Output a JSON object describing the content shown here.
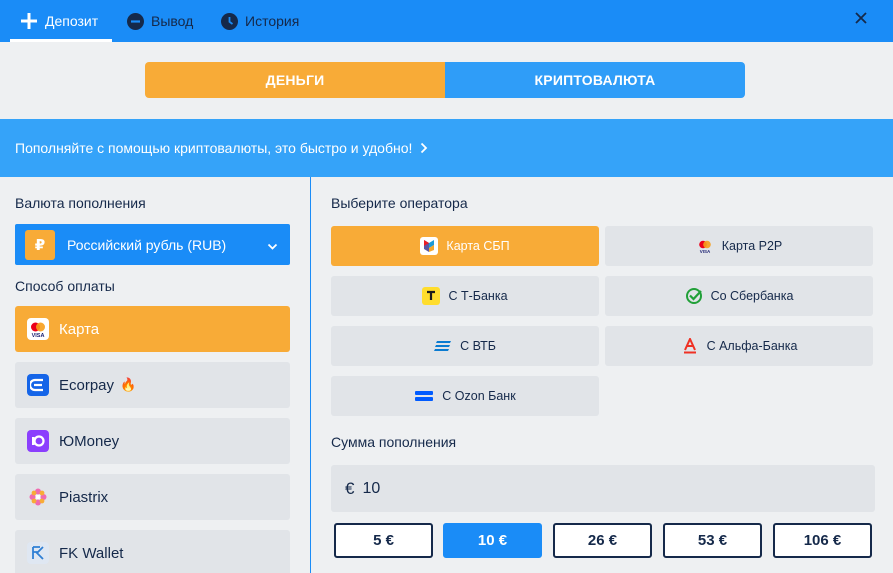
{
  "tabs": [
    {
      "label": "Депозит",
      "icon": "plus-icon",
      "active": true
    },
    {
      "label": "Вывод",
      "icon": "minus-circle-icon"
    },
    {
      "label": "История",
      "icon": "clock-icon"
    }
  ],
  "mode_switch": {
    "money": "ДЕНЬГИ",
    "crypto": "КРИПТОВАЛЮТА",
    "active": "money"
  },
  "banner": {
    "text": "Пополняйте с помощью криптовалюты, это быстро и удобно!"
  },
  "left": {
    "currency_label": "Валюта пополнения",
    "currency_symbol": "₽",
    "currency_value": "Российский рубль (RUB)",
    "method_label": "Способ оплаты",
    "methods": [
      {
        "label": "Карта",
        "icon": "card-icon",
        "active": true
      },
      {
        "label": "Ecorpay",
        "icon": "ecorpay-icon",
        "badge": "🔥"
      },
      {
        "label": "ЮMoney",
        "icon": "yoomoney-icon"
      },
      {
        "label": "Piastrix",
        "icon": "piastrix-icon"
      },
      {
        "label": "FK Wallet",
        "icon": "fkwallet-icon"
      }
    ]
  },
  "right": {
    "operator_label": "Выберите оператора",
    "operators": [
      {
        "label": "Карта СБП",
        "icon": "sbp-icon",
        "active": true
      },
      {
        "label": "Карта P2P",
        "icon": "card-icon"
      },
      {
        "label": "С Т-Банка",
        "icon": "tbank-icon"
      },
      {
        "label": "Со Сбербанка",
        "icon": "sberbank-icon"
      },
      {
        "label": "С ВТБ",
        "icon": "vtb-icon"
      },
      {
        "label": "С Альфа-Банка",
        "icon": "alfabank-icon"
      },
      {
        "label": "С Ozon Банк",
        "icon": "ozonbank-icon"
      }
    ],
    "amount_label": "Сумма пополнения",
    "amount_currency": "€",
    "amount_value": "10",
    "presets": [
      {
        "label": "5 €"
      },
      {
        "label": "10 €",
        "active": true
      },
      {
        "label": "26 €"
      },
      {
        "label": "53 €"
      },
      {
        "label": "106 €"
      }
    ]
  },
  "colors": {
    "accent_blue": "#1a8cf7",
    "accent_orange": "#f8ab37",
    "text_dark": "#15294a"
  }
}
